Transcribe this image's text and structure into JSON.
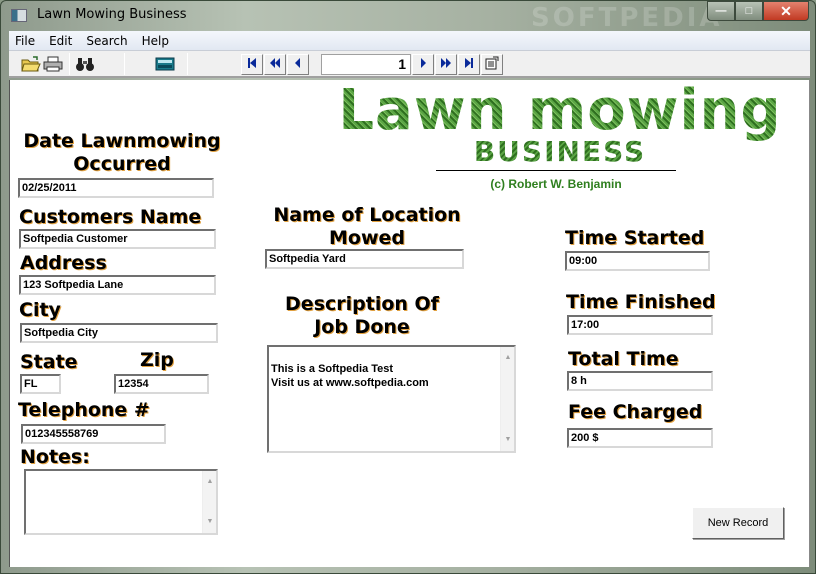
{
  "window": {
    "title": "Lawn Mowing Business",
    "watermark": "SOFTPEDIA",
    "buttons": {
      "minimize": "—",
      "maximize": "□",
      "close": "✕"
    }
  },
  "menu": [
    "File",
    "Edit",
    "Search",
    "Help"
  ],
  "toolbar": {
    "icons": [
      "open-folder-icon",
      "print-icon",
      "find-binoculars-icon",
      "calculator-icon"
    ],
    "navigation": {
      "first": "◄▌",
      "previous_page": "◄◄",
      "previous": "◄",
      "record_number": "1",
      "next": "►",
      "next_page": "►►",
      "last": "►▌",
      "properties": "📋"
    }
  },
  "logo": {
    "title": "Lawn mowing",
    "subtitle": "BUSINESS",
    "copyright": "(c) Robert W. Benjamin",
    "color": "#3e8a2c"
  },
  "form": {
    "date": {
      "label_line1": "Date Lawnmowing",
      "label_line2": "Occurred",
      "value": "02/25/2011"
    },
    "customer_name": {
      "label": "Customers Name",
      "value": "Softpedia Customer"
    },
    "address": {
      "label": "Address",
      "value": "123 Softpedia Lane"
    },
    "city": {
      "label": "City",
      "value": "Softpedia City"
    },
    "state": {
      "label": "State",
      "value": "FL"
    },
    "zip": {
      "label": "Zip",
      "value": "12354"
    },
    "telephone": {
      "label": "Telephone #",
      "value": "012345558769"
    },
    "notes": {
      "label": "Notes:",
      "value": ""
    },
    "location": {
      "label_line1": "Name of Location",
      "label_line2": "Mowed",
      "value": "Softpedia Yard"
    },
    "description": {
      "label_line1": "Description Of",
      "label_line2": "Job Done",
      "value": "This is a Softpedia Test\nVisit us at www.softpedia.com"
    },
    "time_started": {
      "label": "Time Started",
      "value": "09:00"
    },
    "time_finished": {
      "label": "Time Finished",
      "value": "17:00"
    },
    "total_time": {
      "label": "Total Time",
      "value": "8 h"
    },
    "fee_charged": {
      "label": "Fee Charged",
      "value": "200 $"
    }
  },
  "actions": {
    "new_record": "New Record"
  }
}
